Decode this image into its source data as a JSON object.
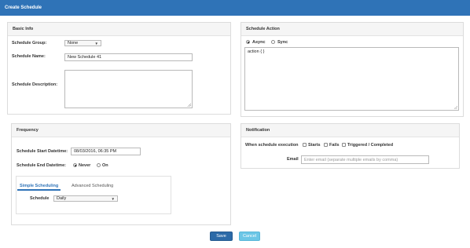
{
  "header": {
    "title": "Create Schedule"
  },
  "basic_info": {
    "title": "Basic Info",
    "group_label": "Schedule Group:",
    "group_value": "None",
    "name_label": "Schedule Name:",
    "name_value": "New Schedule 41",
    "description_label": "Schedule Description:",
    "description_value": ""
  },
  "schedule_action": {
    "title": "Schedule Action",
    "async_label": "Async",
    "sync_label": "Sync",
    "selected": "Async",
    "code": "action { }"
  },
  "frequency": {
    "title": "Frequency",
    "start_label": "Schedule Start Datetime:",
    "start_value": "08/03/2016, 06:35 PM",
    "end_label": "Schedule End Datetime:",
    "never_label": "Never",
    "on_label": "On",
    "end_selected": "Never",
    "tabs": [
      {
        "label": "Simple Scheduling",
        "active": true
      },
      {
        "label": "Advanced Scheduling",
        "active": false
      }
    ],
    "schedule_label": "Schedule",
    "schedule_value": "Daily"
  },
  "notification": {
    "title": "Notification",
    "when_label": "When schedule execution",
    "options": [
      {
        "label": "Starts",
        "checked": false
      },
      {
        "label": "Fails",
        "checked": false
      },
      {
        "label": "Triggered / Completed",
        "checked": false
      }
    ],
    "email_label": "Email",
    "email_placeholder": "Enter email (separate multiple emails by comma)"
  },
  "actions": {
    "save_label": "Save",
    "cancel_label": "Cancel"
  },
  "colors": {
    "header": "#2f73b7",
    "save": "#2c6aa8",
    "cancel": "#6cc6e6",
    "accent_tab": "#2f73b7"
  }
}
